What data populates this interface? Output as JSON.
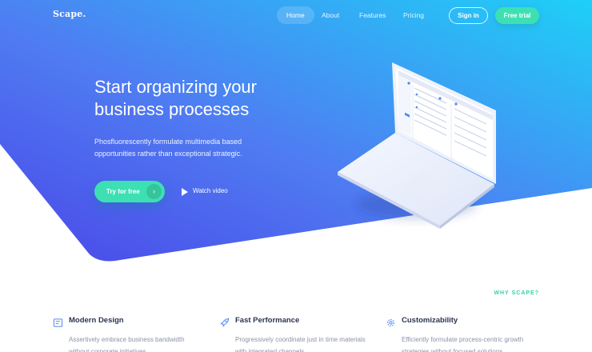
{
  "brand": {
    "logo": "Scape."
  },
  "nav": {
    "items": [
      {
        "label": "Home",
        "active": true
      },
      {
        "label": "About",
        "active": false
      },
      {
        "label": "Features",
        "active": false
      },
      {
        "label": "Pricing",
        "active": false
      }
    ],
    "signin_label": "Sign in",
    "trial_label": "Free trial"
  },
  "hero": {
    "headline_line1": "Start organizing your",
    "headline_line2": "business processes",
    "subtext_line1": "Phosfluorescently formulate multimedia based",
    "subtext_line2": "opportunities rather than exceptional strategic.",
    "cta_label": "Try for free",
    "video_label": "Watch video"
  },
  "why": {
    "tag": "WHY SCAPE?",
    "features": [
      {
        "icon": "tablet-icon",
        "title": "Modern Design",
        "desc_line1": "Assertively embrace business bandwidth",
        "desc_line2": "without corporate initiatives."
      },
      {
        "icon": "rocket-icon",
        "title": "Fast Performance",
        "desc_line1": "Progressively coordinate just in time materials",
        "desc_line2": "with integrated channels."
      },
      {
        "icon": "gear-icon",
        "title": "Customizability",
        "desc_line1": "Efficiently formulate process-centric growth",
        "desc_line2": "strategies without focused solutions."
      }
    ]
  },
  "colors": {
    "gradient_start": "#5a4ff0",
    "gradient_end": "#22c8f5",
    "accent": "#3de0b2",
    "title": "#2b3450",
    "muted": "#8b93a8"
  }
}
